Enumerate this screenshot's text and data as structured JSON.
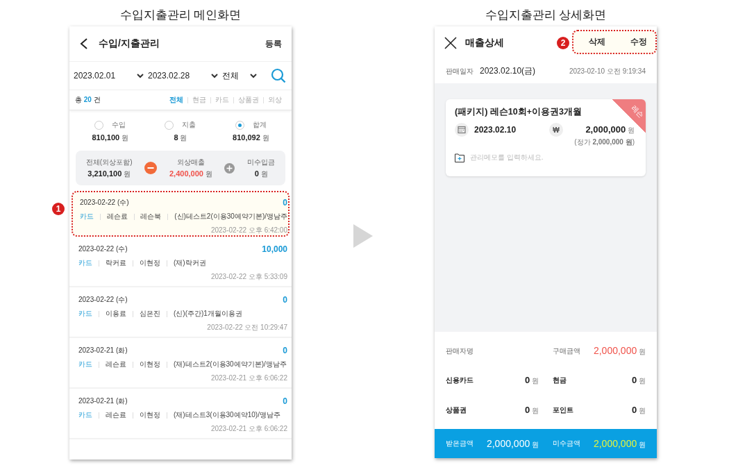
{
  "left_screen": {
    "caption": "수입지출관리 메인화면",
    "title": "수입/지출관리",
    "action": "등록",
    "filters": {
      "start_date": "2023.02.01",
      "end_date": "2023.02.28",
      "type": "전체"
    },
    "count": {
      "prefix": "총",
      "value": "20",
      "suffix": "건"
    },
    "payment_tabs": [
      {
        "label": "전체",
        "selected": true
      },
      {
        "label": "현금",
        "selected": false
      },
      {
        "label": "카드",
        "selected": false
      },
      {
        "label": "상품권",
        "selected": false
      },
      {
        "label": "외상",
        "selected": false
      }
    ],
    "totals": [
      {
        "label": "수입",
        "amount": "810,100",
        "unit": "원",
        "selected": false
      },
      {
        "label": "지출",
        "amount": "8",
        "unit": "원",
        "selected": false
      },
      {
        "label": "합계",
        "amount": "810,092",
        "unit": "원",
        "selected": true
      }
    ],
    "summary": [
      {
        "label": "전체(외상포함)",
        "amount": "3,210,100",
        "unit": "원",
        "kind": "total"
      },
      {
        "label": "외상매출",
        "amount": "2,400,000",
        "unit": "원",
        "kind": "deduct"
      },
      {
        "label": "미수입금",
        "amount": "0",
        "unit": "원",
        "kind": "add"
      }
    ],
    "marker": "1",
    "transactions": [
      {
        "date": "2023-02-22 (수)",
        "amount": "0",
        "tags": [
          "카드",
          "레슨료",
          "레슨북",
          "(신)테스트2(이용30예약기본)/맹남주"
        ],
        "timestamp": "2023-02-22 오후 6:42:00",
        "highlighted": true
      },
      {
        "date": "2023-02-22 (수)",
        "amount": "10,000",
        "tags": [
          "카드",
          "락커료",
          "이현정",
          "(재)락커권"
        ],
        "timestamp": "2023-02-22 오후 5:33:09",
        "highlighted": false
      },
      {
        "date": "2023-02-22 (수)",
        "amount": "0",
        "tags": [
          "카드",
          "이용료",
          "심은진",
          "(신)(주간)1개월이용권"
        ],
        "timestamp": "2023-02-22 오전 10:29:47",
        "highlighted": false
      },
      {
        "date": "2023-02-21 (화)",
        "amount": "0",
        "tags": [
          "카드",
          "레슨료",
          "이현정",
          "(재)테스트2(이용30예약기본)/맹남주"
        ],
        "timestamp": "2023-02-21 오후 6:06:22",
        "highlighted": false
      },
      {
        "date": "2023-02-21 (화)",
        "amount": "0",
        "tags": [
          "카드",
          "레슨료",
          "이현정",
          "(재)테스트3(이용30예약10)/맹남주"
        ],
        "timestamp": "2023-02-21 오후 6:06:22",
        "highlighted": false
      }
    ]
  },
  "right_screen": {
    "caption": "수입지출관리 상세화면",
    "title": "매출상세",
    "actions": [
      "삭제",
      "수정"
    ],
    "actions_highlighted": true,
    "marker": "2",
    "sale_date_label": "판매일자",
    "sale_date": "2023.02.10(금)",
    "created": "2023-02-10 오전 9:19:34",
    "product": {
      "name": "(패키지) 레슨10회+이용권3개월",
      "tag": "레슨",
      "date": "2023.02.10",
      "currency_symbol": "₩",
      "price": "2,000,000",
      "unit": "원",
      "list_price": "(정가 **2,000,000 원**)",
      "memo_hint": "관리메모를 입력하세요."
    },
    "details": [
      {
        "label": "판매자명",
        "kind": "info"
      },
      {
        "label": "구매금액",
        "amount": "2,000,000",
        "unit": "원",
        "kind": "total"
      },
      {
        "label": "신용카드",
        "amount": "0",
        "unit": "원",
        "kind": "payment"
      },
      {
        "label": "현금",
        "amount": "0",
        "unit": "원",
        "kind": "payment"
      },
      {
        "label": "상품권",
        "amount": "0",
        "unit": "원",
        "kind": "payment"
      },
      {
        "label": "포인트",
        "amount": "0",
        "unit": "원",
        "kind": "payment"
      }
    ],
    "footer": [
      {
        "label": "받은금액",
        "amount": "2,000,000",
        "unit": "원",
        "kind": "received"
      },
      {
        "label": "미수금액",
        "amount": "2,000,000",
        "unit": "원",
        "kind": "outstanding"
      }
    ]
  }
}
